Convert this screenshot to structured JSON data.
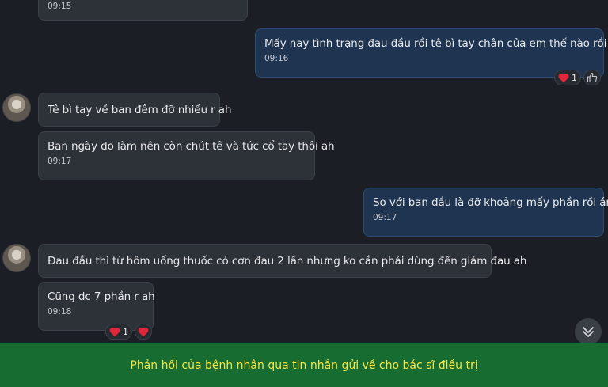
{
  "messages": [
    {
      "text": "",
      "time": "09:15"
    },
    {
      "text": "Mấy nay tình trạng đau đầu rồi tê bì tay chân của em thế nào rồi Ánh",
      "time": "09:16"
    },
    {
      "text": "Tê bì tay về ban đêm đỡ nhiều r ah",
      "time": ""
    },
    {
      "text": "Ban ngày do làm nên còn chút tê và tức cổ tay thôi ah",
      "time": "09:17"
    },
    {
      "text": "So với ban đầu là đỡ khoảng mấy phần rồi ánh",
      "time": "09:17"
    },
    {
      "text": "Đau đầu thì từ hôm uống thuốc có cơn đau 2 lần nhưng ko cần phải dùng đến giảm đau ah",
      "time": ""
    },
    {
      "text": "Cũng dc 7 phần r ah",
      "time": "09:18"
    }
  ],
  "reactions": {
    "msg1": {
      "heart_count": "1",
      "icons": [
        "heart-icon",
        "thumbs-up-icon"
      ]
    },
    "msg6": {
      "heart_count": "1",
      "icons": [
        "heart-icon",
        "heart-icon"
      ]
    }
  },
  "caption": "Phản hồi của bệnh nhân qua tin nhắn gửi về cho bác sĩ điều trị",
  "colors": {
    "background": "#1b1e24",
    "incoming_bubble": "#2d3138",
    "outgoing_bubble": "#1e3450",
    "caption_bar": "#166c31",
    "caption_text": "#f4e74a",
    "heart": "#e0263a"
  }
}
